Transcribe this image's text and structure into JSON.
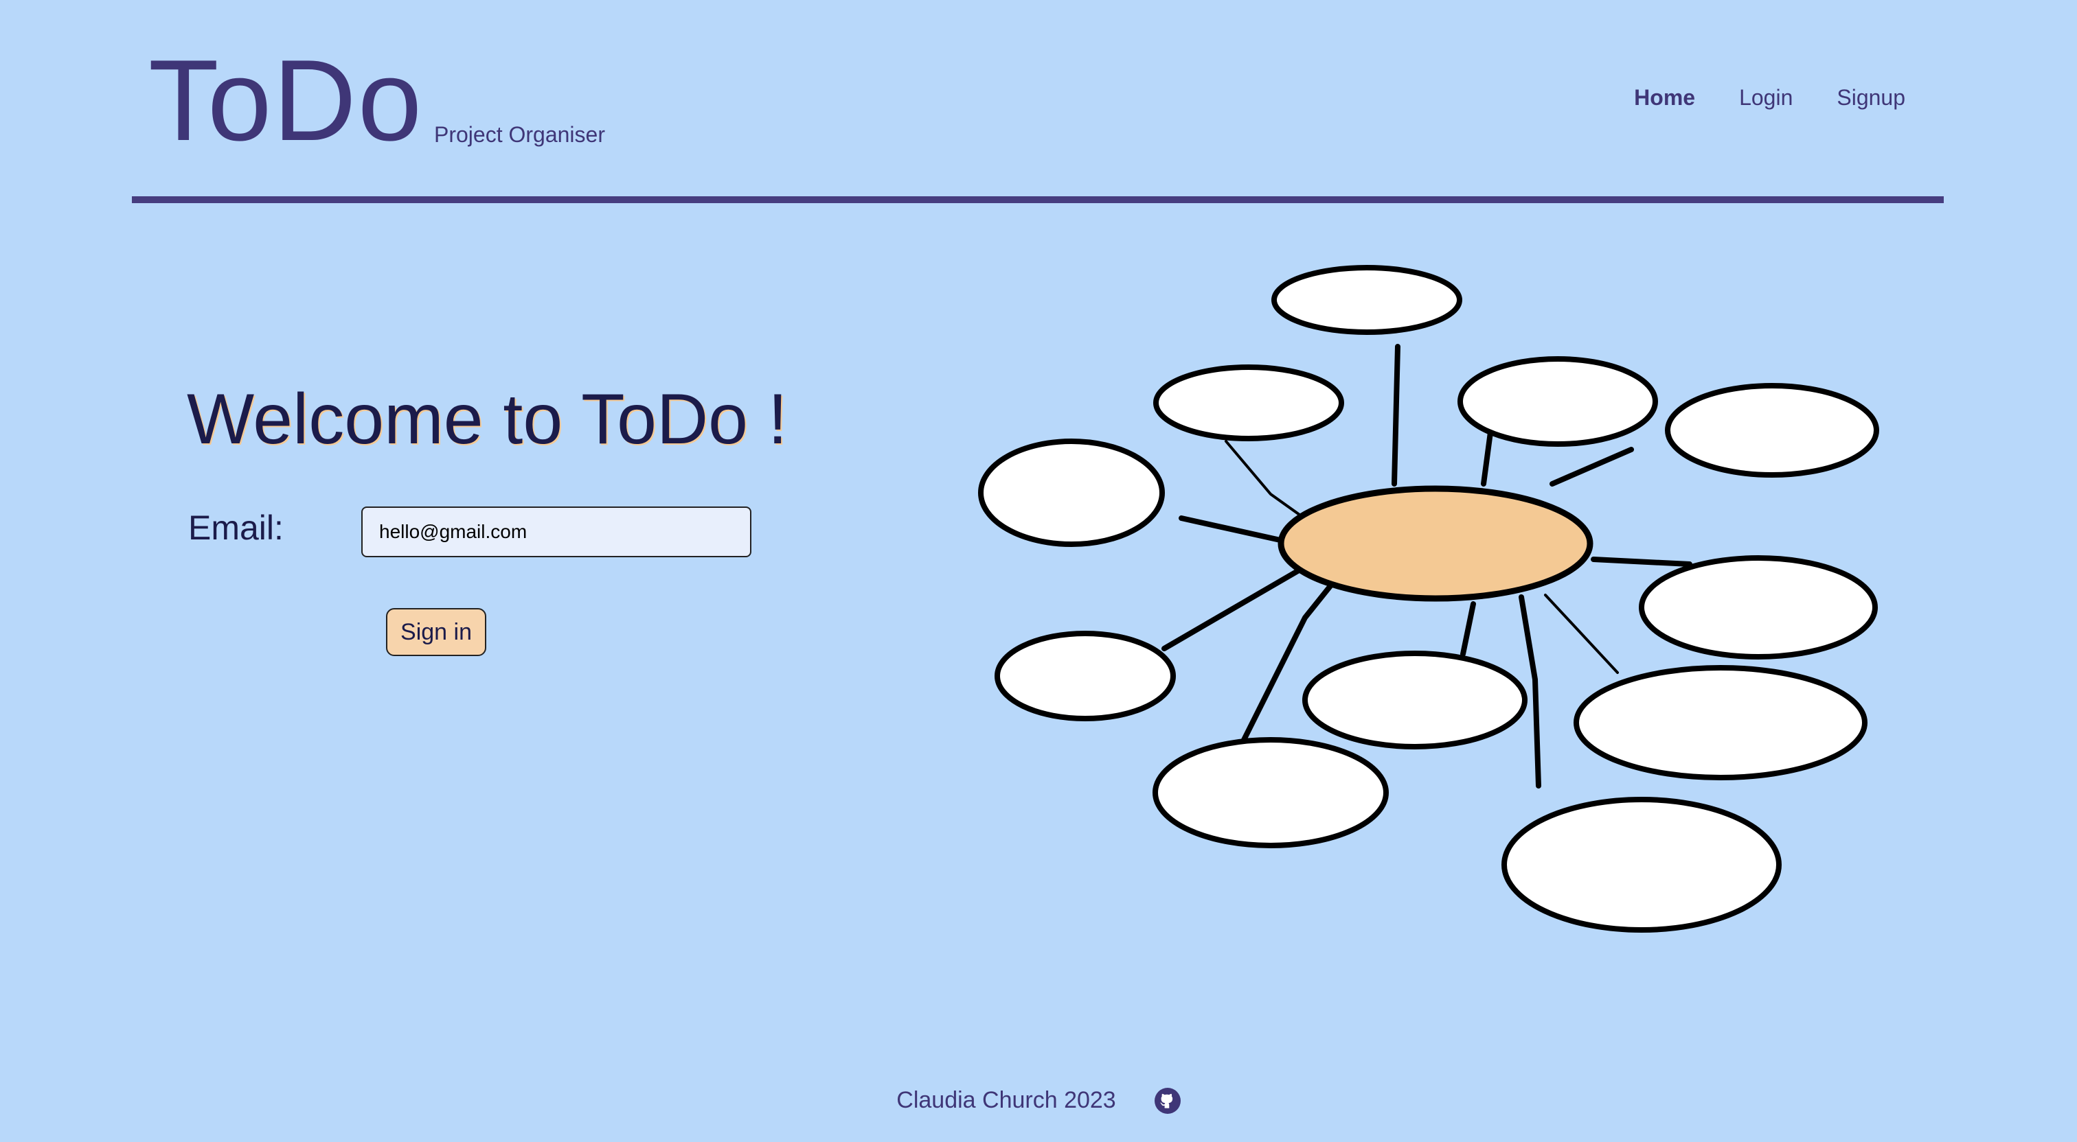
{
  "header": {
    "logo": "ToDo",
    "tagline": "Project Organiser",
    "nav": [
      {
        "label": "Home",
        "active": true
      },
      {
        "label": "Login",
        "active": false
      },
      {
        "label": "Signup",
        "active": false
      }
    ]
  },
  "main": {
    "welcome_title": "Welcome to ToDo !",
    "email_label": "Email:",
    "email_value": "hello@gmail.com",
    "signin_label": "Sign in",
    "illustration": "mind-map"
  },
  "footer": {
    "credit": "Claudia Church 2023",
    "icon": "github-icon"
  },
  "colors": {
    "background": "#b8d8fa",
    "brand": "#3f3677",
    "accent": "#f4c994",
    "input_bg": "#e8effc"
  }
}
